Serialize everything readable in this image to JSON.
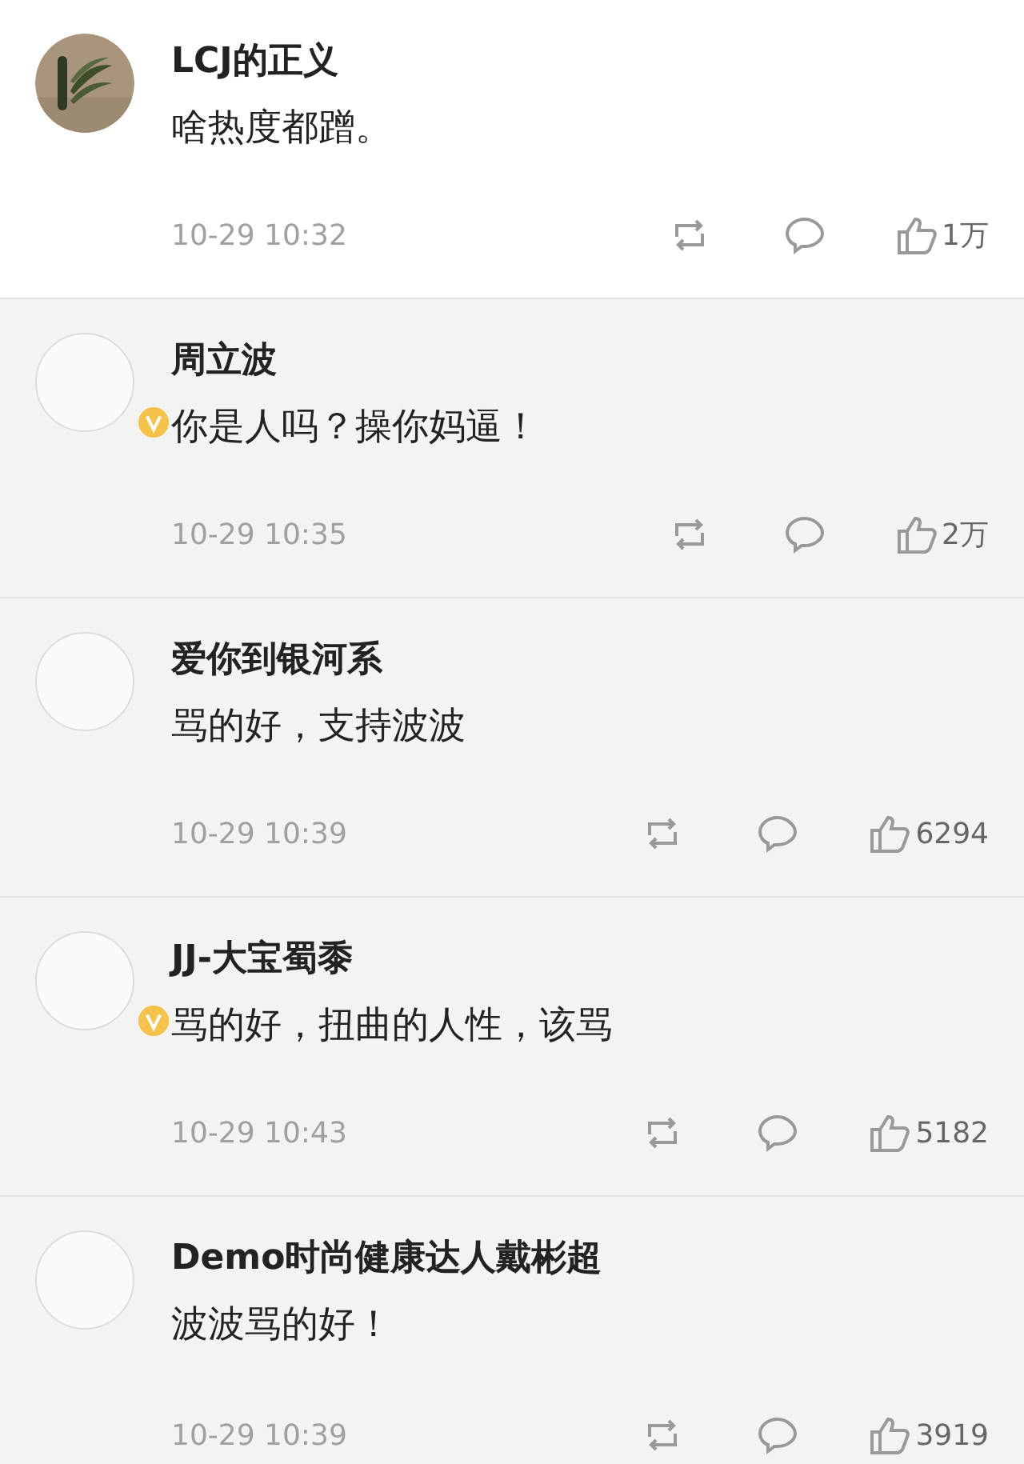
{
  "comments": [
    {
      "user": "LCJ的正义",
      "has_photo": true,
      "verified": false,
      "shaded": false,
      "text": "啥热度都蹭。",
      "time": "10-29 10:32",
      "likes": "1万"
    },
    {
      "user": "周立波",
      "has_photo": false,
      "verified": true,
      "shaded": true,
      "text": "你是人吗？操你妈逼！",
      "time": "10-29 10:35",
      "likes": "2万"
    },
    {
      "user": "爱你到银河系",
      "has_photo": false,
      "verified": false,
      "shaded": true,
      "text": "骂的好，支持波波",
      "time": "10-29 10:39",
      "likes": "6294"
    },
    {
      "user": "JJ-大宝蜀黍",
      "has_photo": false,
      "verified": true,
      "shaded": true,
      "text": "骂的好，扭曲的人性，该骂",
      "time": "10-29 10:43",
      "likes": "5182"
    },
    {
      "user": "Demo时尚健康达人戴彬超",
      "has_photo": false,
      "verified": false,
      "shaded": true,
      "text": "波波骂的好！",
      "time": "10-29 10:39",
      "likes": "3919"
    }
  ]
}
